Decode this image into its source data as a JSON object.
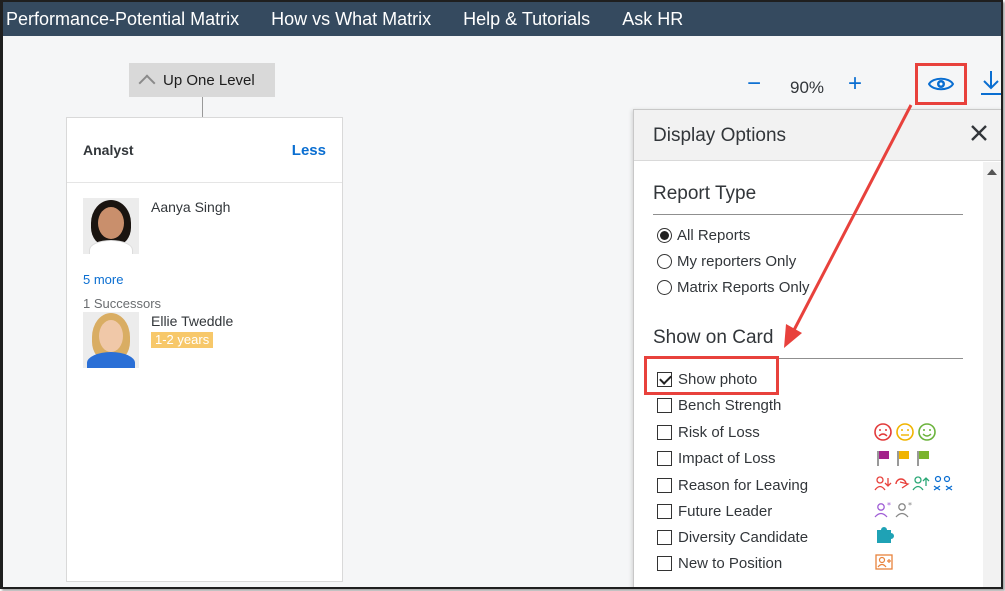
{
  "nav": {
    "items": [
      "Performance-Potential Matrix",
      "How vs What Matrix",
      "Help & Tutorials",
      "Ask HR"
    ]
  },
  "toolbar": {
    "up_one_level": "Up One Level",
    "zoom_minus": "−",
    "zoom_value": "90%",
    "zoom_plus": "+",
    "view_icon": "eye-icon",
    "download_icon": "download-icon"
  },
  "card": {
    "title": "Analyst",
    "toggle": "Less",
    "incumbent": {
      "name": "Aanya Singh"
    },
    "more_link": "5 more",
    "successors_count": "1 Successors",
    "successor": {
      "name": "Ellie Tweddle",
      "readiness": "1-2 years"
    }
  },
  "panel": {
    "title": "Display Options",
    "report_type": {
      "heading": "Report Type",
      "options": [
        "All Reports",
        "My reporters Only",
        "Matrix Reports Only"
      ],
      "selected": "All Reports"
    },
    "show_on_card": {
      "heading": "Show on Card",
      "options": [
        {
          "label": "Show photo",
          "checked": true
        },
        {
          "label": "Bench Strength",
          "checked": false
        },
        {
          "label": "Risk of Loss",
          "checked": false
        },
        {
          "label": "Impact of Loss",
          "checked": false
        },
        {
          "label": "Reason for Leaving",
          "checked": false
        },
        {
          "label": "Future Leader",
          "checked": false
        },
        {
          "label": "Diversity Candidate",
          "checked": false
        },
        {
          "label": "New to Position",
          "checked": false
        }
      ]
    }
  },
  "colors": {
    "nav_bg": "#354a5f",
    "link": "#0a6ed1",
    "highlight": "#e8413c",
    "readiness_badge": "#f7c86a"
  }
}
